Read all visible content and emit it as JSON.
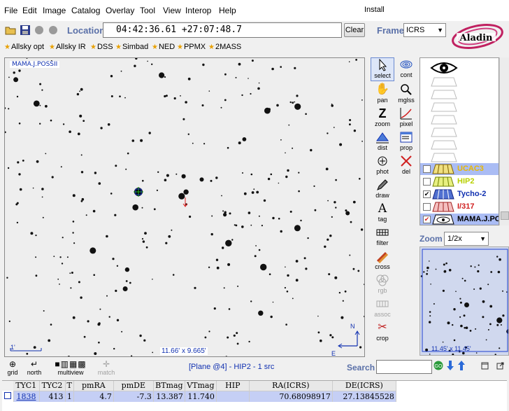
{
  "menu": {
    "items": [
      "File",
      "Edit",
      "Image",
      "Catalog",
      "Overlay",
      "Tool",
      "View",
      "Interop",
      "Help"
    ],
    "install": "Install"
  },
  "location": {
    "label": "Location",
    "value": "04:42:36.61 +27:07:48.7",
    "clear_label": "Clear"
  },
  "frame": {
    "label": "Frame",
    "value": "ICRS"
  },
  "bookmarks": [
    "Allsky opt",
    "Allsky IR",
    "DSS",
    "Simbad",
    "NED",
    "PPMX",
    "2MASS"
  ],
  "view": {
    "survey": "MAMA.J.POSSII",
    "scale": "1'",
    "fov": "11.66' x 9.665'",
    "north": "N",
    "east": "E"
  },
  "tools": [
    {
      "name": "select",
      "label": "select",
      "icon": "arrow-cursor-icon",
      "selected": true
    },
    {
      "name": "cont",
      "label": "cont",
      "icon": "contour-icon"
    },
    {
      "name": "pan",
      "label": "pan",
      "icon": "hand-icon"
    },
    {
      "name": "mglss",
      "label": "mglss",
      "icon": "magnifier-icon"
    },
    {
      "name": "zoom",
      "label": "zoom",
      "icon": "zoom-z-icon"
    },
    {
      "name": "pixel",
      "label": "pixel",
      "icon": "pixel-curve-icon"
    },
    {
      "name": "dist",
      "label": "dist",
      "icon": "distance-icon"
    },
    {
      "name": "prop",
      "label": "prop",
      "icon": "properties-icon"
    },
    {
      "name": "phot",
      "label": "phot",
      "icon": "photometry-icon"
    },
    {
      "name": "del",
      "label": "del",
      "icon": "delete-x-icon"
    },
    {
      "name": "draw",
      "label": "draw",
      "icon": "pencil-icon"
    },
    {
      "name": "tag",
      "label": "tag",
      "icon": "tag-a-icon"
    },
    {
      "name": "filter",
      "label": "filter",
      "icon": "filter-icon"
    },
    {
      "name": "cross",
      "label": "cross",
      "icon": "crossmatch-icon"
    },
    {
      "name": "rgb",
      "label": "rgb",
      "icon": "rgb-circles-icon",
      "disabled": true
    },
    {
      "name": "assoc",
      "label": "assoc",
      "icon": "assoc-icon",
      "disabled": true
    },
    {
      "name": "crop",
      "label": "crop",
      "icon": "scissors-icon"
    }
  ],
  "layers": [
    {
      "name": "UCAC3",
      "checked": false,
      "color": "#e8b800",
      "selected": true
    },
    {
      "name": "HIP2",
      "checked": false,
      "color": "#b8d000"
    },
    {
      "name": "Tycho-2",
      "checked": true,
      "color": "#1030b0"
    },
    {
      "name": "I/317",
      "checked": false,
      "color": "#d02020"
    },
    {
      "name": "MAMA.J.PO",
      "checked": true,
      "color": "#000000",
      "selected": true
    }
  ],
  "zoom": {
    "label": "Zoom",
    "value": "1/2x",
    "fov": "11.45' x 11.45'"
  },
  "bottom": {
    "grid": "grid",
    "north": "north",
    "multiview": "multiview",
    "match": "match",
    "status": "[Plane @4] - HIP2 - 1 src",
    "search_label": "Search"
  },
  "results": {
    "columns": [
      "TYC1",
      "TYC2",
      "T",
      "pmRA",
      "pmDE",
      "BTmag",
      "VTmag",
      "HIP",
      "RA(ICRS)",
      "DE(ICRS)"
    ],
    "rows": [
      [
        "1838",
        "413",
        "1",
        "4.7",
        "-7.3",
        "13.387",
        "11.740",
        "",
        "70.68098917",
        "27.13845528"
      ]
    ]
  },
  "colors": {
    "accent_label": "#5a70a8",
    "link_blue": "#1030b0",
    "row_highlight": "#c5cff5"
  }
}
